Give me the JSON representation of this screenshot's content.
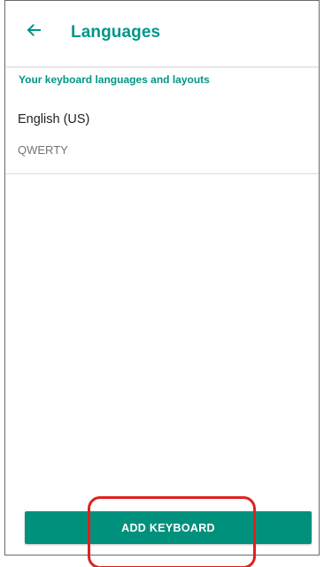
{
  "header": {
    "title": "Languages",
    "back_icon": "arrow-left-icon"
  },
  "section": {
    "header": "Your keyboard languages and layouts"
  },
  "languages": [
    {
      "name": "English (US)",
      "layout": "QWERTY"
    }
  ],
  "footer": {
    "add_button_label": "ADD KEYBOARD"
  },
  "colors": {
    "accent": "#009688",
    "button": "#00917c",
    "highlight": "#e02020"
  }
}
